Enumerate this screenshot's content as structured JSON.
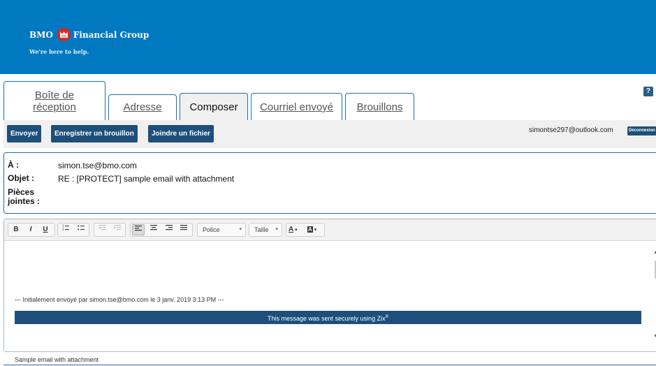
{
  "brand": {
    "name_prefix": "BMO",
    "name_suffix": "Financial Group",
    "tagline": "We're here to help.",
    "banner_color": "#0079c1",
    "roundel_color": "#e2231a"
  },
  "tabs": [
    {
      "label_line1": "Boîte de",
      "label_line2": "réception"
    },
    {
      "label": "Adresse"
    },
    {
      "label": "Composer",
      "active": true
    },
    {
      "label": "Courriel envoyé"
    },
    {
      "label": "Brouillons"
    }
  ],
  "help": {
    "label": "?"
  },
  "toolbar": {
    "send_label": "Envoyer",
    "save_draft_label": "Enregistrer un brouillon",
    "attach_label": "Joindre un fichier",
    "user_email": "simontse297@outlook.com",
    "logout_label": "Déconnexion",
    "button_color": "#1e4f7a"
  },
  "fields": {
    "to_label": "À :",
    "to_value": "simon.tse@bmo.com",
    "subject_label": "Objet :",
    "subject_value": "RE : [PROTECT] sample email with attachment",
    "attachments_label_line1": "Pièces",
    "attachments_label_line2": "jointes :"
  },
  "editor_toolbar": {
    "bold": "B",
    "italic": "I",
    "underline": "U",
    "font_combo": "Police",
    "size_combo": "Taille",
    "text_color": "A",
    "bg_color": "A",
    "icons": [
      "ordered-list-icon",
      "unordered-list-icon",
      "outdent-icon",
      "indent-icon",
      "align-left-icon",
      "align-center-icon",
      "align-right-icon",
      "justify-icon"
    ]
  },
  "message": {
    "forward_line": "--- Initialement envoyé par simon.tse@bmo.com le 3 janv. 2019 3:13 PM ---",
    "zix_notice": "This message was sent securely using Zix",
    "zix_mark": "®",
    "body_text": "Sample email with attachment"
  }
}
